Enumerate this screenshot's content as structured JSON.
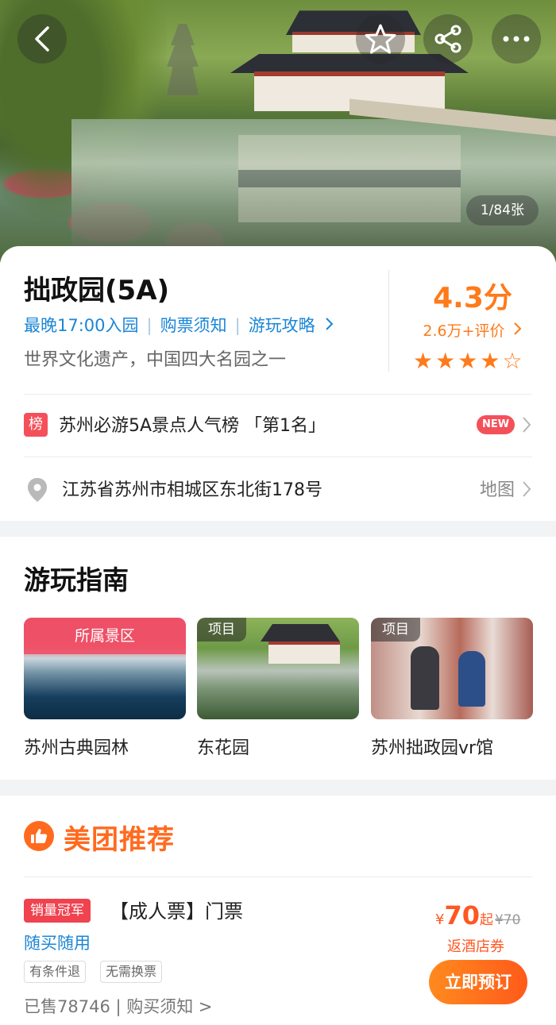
{
  "hero": {
    "photo_counter": "1/84张"
  },
  "attraction": {
    "name": "拙政园(5A)",
    "links": [
      "最晚17:00入园",
      "购票须知",
      "游玩攻略"
    ],
    "description": "世界文化遗产，中国四大名园之一",
    "score": "4.3分",
    "reviews": "2.6万+评价",
    "stars_value": 4.5
  },
  "ranking": {
    "badge": "榜",
    "text": "苏州必游5A景点人气榜 「第1名」",
    "new_badge": "NEW"
  },
  "address": {
    "text": "江苏省苏州市相城区东北街178号",
    "map_label": "地图"
  },
  "guide": {
    "title": "游玩指南",
    "cards": [
      {
        "banner": "所属景区",
        "label": "苏州古典园林"
      },
      {
        "tag": "项目",
        "label": "东花园"
      },
      {
        "tag": "项目",
        "label": "苏州拙政园vr馆"
      }
    ]
  },
  "recommend": {
    "title": "美团推荐",
    "item": {
      "sales_badge": "销量冠军",
      "name": "【成人票】门票",
      "usage": "随买随用",
      "chips": [
        "有条件退",
        "无需换票"
      ],
      "sold": "已售78746 | 购买须知 >",
      "currency": "¥",
      "price": "70",
      "price_suffix": "起",
      "original_price": "¥70",
      "hotel_coupon": "返酒店券",
      "book_label": "立即预订"
    }
  },
  "colors": {
    "accent": "#ff7a1a",
    "link": "#1b86d6",
    "badge_red": "#f0424f"
  }
}
